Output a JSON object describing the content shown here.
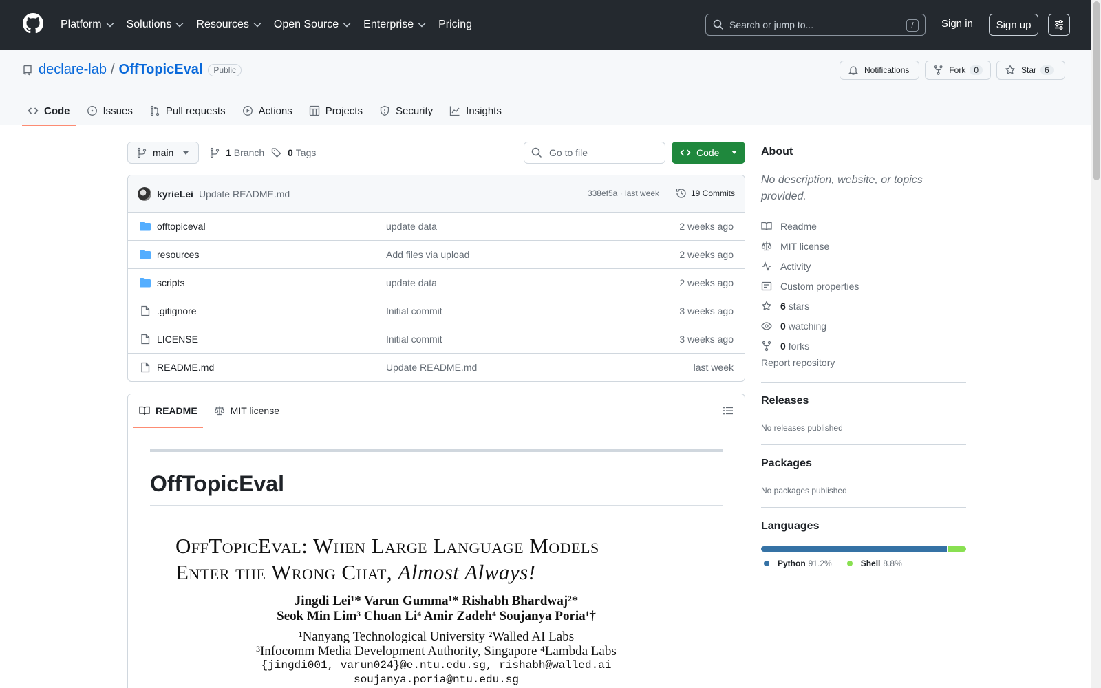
{
  "header": {
    "nav": [
      "Platform",
      "Solutions",
      "Resources",
      "Open Source",
      "Enterprise",
      "Pricing"
    ],
    "search_placeholder": "Search or jump to...",
    "search_shortcut": "/",
    "signin": "Sign in",
    "signup": "Sign up"
  },
  "repo": {
    "owner": "declare-lab",
    "separator": "/",
    "name": "OffTopicEval",
    "visibility": "Public",
    "notifications": "Notifications",
    "fork_label": "Fork",
    "fork_count": "0",
    "star_label": "Star",
    "star_count": "6",
    "tabs": [
      "Code",
      "Issues",
      "Pull requests",
      "Actions",
      "Projects",
      "Security",
      "Insights"
    ]
  },
  "toolbar": {
    "branch": "main",
    "branches_count": "1",
    "branches_label": "Branch",
    "tags_count": "0",
    "tags_label": "Tags",
    "goto_placeholder": "Go to file",
    "code_button": "Code"
  },
  "commit": {
    "author": "kyrieLei",
    "message": "Update README.md",
    "meta": "338ef5a · last week",
    "commits": "19 Commits"
  },
  "files": [
    {
      "type": "folder",
      "name": "offtopiceval",
      "commit": "update data",
      "date": "2 weeks ago"
    },
    {
      "type": "folder",
      "name": "resources",
      "commit": "Add files via upload",
      "date": "2 weeks ago"
    },
    {
      "type": "folder",
      "name": "scripts",
      "commit": "update data",
      "date": "2 weeks ago"
    },
    {
      "type": "file",
      "name": ".gitignore",
      "commit": "Initial commit",
      "date": "3 weeks ago"
    },
    {
      "type": "file",
      "name": "LICENSE",
      "commit": "Initial commit",
      "date": "3 weeks ago"
    },
    {
      "type": "file",
      "name": "README.md",
      "commit": "Update README.md",
      "date": "last week"
    }
  ],
  "readme": {
    "tab_readme": "README",
    "tab_license": "MIT license",
    "heading": "OffTopicEval",
    "paper": {
      "title_line1": "OffTopicEval:  When Large Language Models",
      "title_line2_a": "Enter the Wrong Chat, ",
      "title_line2_b": "Almost Always!",
      "authors_line1": "Jingdi Lei¹* Varun Gumma¹* Rishabh Bhardwaj²*",
      "authors_line2": "Seok Min Lim³ Chuan Li⁴ Amir Zadeh⁴ Soujanya Poria¹†",
      "affil_line1": "¹Nanyang Technological University ²Walled AI Labs",
      "affil_line2": "³Infocomm Media Development Authority, Singapore ⁴Lambda Labs",
      "email_line1": "{jingdi001, varun024}@e.ntu.edu.sg, rishabh@walled.ai",
      "email_line2": "soujanya.poria@ntu.edu.sg"
    }
  },
  "sidebar": {
    "about_title": "About",
    "about_desc": "No description, website, or topics provided.",
    "items": [
      {
        "icon": "book-icon",
        "strong": "",
        "label": "Readme"
      },
      {
        "icon": "law-icon",
        "strong": "",
        "label": "MIT license"
      },
      {
        "icon": "pulse-icon",
        "strong": "",
        "label": "Activity"
      },
      {
        "icon": "note-icon",
        "strong": "",
        "label": "Custom properties"
      },
      {
        "icon": "star-icon",
        "strong": "6",
        "label": "stars"
      },
      {
        "icon": "eye-icon",
        "strong": "0",
        "label": "watching"
      },
      {
        "icon": "fork-icon",
        "strong": "0",
        "label": "forks"
      }
    ],
    "report": "Report repository",
    "releases_title": "Releases",
    "releases_sub": "No releases published",
    "packages_title": "Packages",
    "packages_sub": "No packages published",
    "languages_title": "Languages",
    "languages": [
      {
        "name": "Python",
        "percent": "91.2%",
        "value": 91.2,
        "color": "#3572A5"
      },
      {
        "name": "Shell",
        "percent": "8.8%",
        "value": 8.8,
        "color": "#89e051"
      }
    ]
  }
}
